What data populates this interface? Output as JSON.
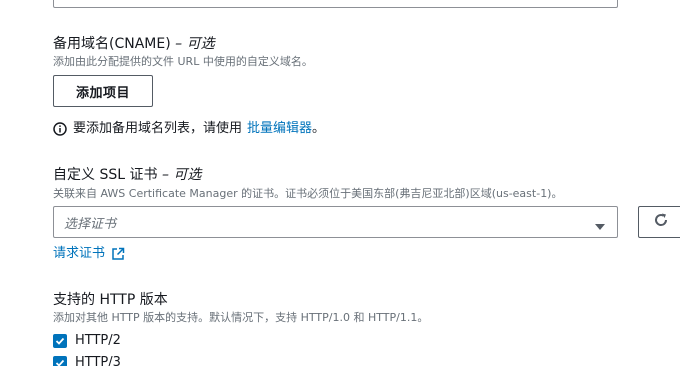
{
  "cname": {
    "label": "备用域名(CNAME)",
    "optional": "– 可选",
    "description": "添加由此分配提供的文件 URL 中使用的自定义域名。",
    "add_button": "添加项目",
    "info_text": "要添加备用域名列表，请使用",
    "info_link": "批量编辑器",
    "info_suffix": "。"
  },
  "ssl": {
    "label": "自定义 SSL 证书",
    "optional": "– 可选",
    "description": "关联来自 AWS Certificate Manager 的证书。证书必须位于美国东部(弗吉尼亚北部)区域(us-east-1)。",
    "select_placeholder": "选择证书",
    "request_link": "请求证书"
  },
  "http": {
    "label": "支持的 HTTP 版本",
    "description": "添加对其他 HTTP 版本的支持。默认情况下，支持 HTTP/1.0 和 HTTP/1.1。",
    "options": [
      {
        "label": "HTTP/2",
        "checked": true
      },
      {
        "label": "HTTP/3",
        "checked": true
      }
    ]
  },
  "colors": {
    "link": "#0073bb",
    "checkbox": "#0073bb",
    "text": "#16191f",
    "muted": "#687078"
  }
}
